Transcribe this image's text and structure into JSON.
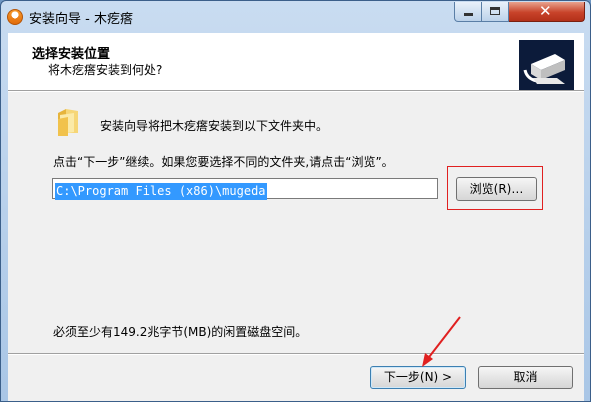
{
  "window": {
    "title": "安装向导 - 木疙瘩"
  },
  "header": {
    "title": "选择安装位置",
    "subtitle": "将木疙瘩安装到何处?"
  },
  "main": {
    "intro": "安装向导将把木疙瘩安装到以下文件夹中。",
    "instruction": "点击“下一步”继续。如果您要选择不同的文件夹,请点击“浏览”。",
    "path_value": "C:\\Program Files (x86)\\mugeda",
    "browse_label": "浏览(R)…",
    "space_required": "必须至少有149.2兆字节(MB)的闲置磁盘空间。"
  },
  "footer": {
    "next_label": "下一步(N) >",
    "cancel_label": "取消"
  },
  "colors": {
    "selection": "#3399ff",
    "annotation": "#e02020",
    "title_close": "#c8432a"
  },
  "icons": [
    "app-icon",
    "minimize-icon",
    "maximize-icon",
    "close-icon",
    "installer-logo-icon",
    "folder-icon",
    "annotation-arrow"
  ]
}
